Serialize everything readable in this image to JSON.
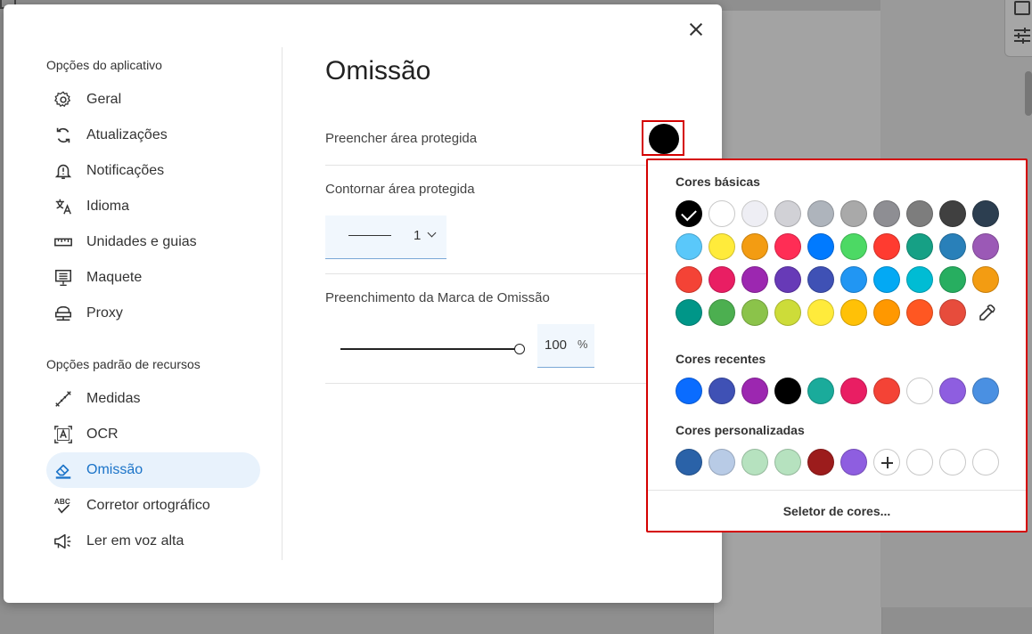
{
  "dialog": {
    "title": "Omissão",
    "close_label": "close"
  },
  "sidebar": {
    "app_section_title": "Opções do aplicativo",
    "resource_section_title": "Opções padrão de recursos",
    "app_items": [
      {
        "label": "Geral",
        "icon": "gear-icon"
      },
      {
        "label": "Atualizações",
        "icon": "refresh-icon"
      },
      {
        "label": "Notificações",
        "icon": "bell-alert-icon"
      },
      {
        "label": "Idioma",
        "icon": "translate-icon"
      },
      {
        "label": "Unidades e guias",
        "icon": "ruler-icon"
      },
      {
        "label": "Maquete",
        "icon": "monitor-icon"
      },
      {
        "label": "Proxy",
        "icon": "proxy-icon"
      }
    ],
    "resource_items": [
      {
        "label": "Medidas",
        "icon": "measure-icon"
      },
      {
        "label": "OCR",
        "icon": "ocr-icon"
      },
      {
        "label": "Omissão",
        "icon": "eraser-icon",
        "active": true
      },
      {
        "label": "Corretor ortográfico",
        "icon": "spellcheck-icon"
      },
      {
        "label": "Ler em voz alta",
        "icon": "megaphone-icon"
      }
    ]
  },
  "settings": {
    "fill_label": "Preencher área protegida",
    "fill_color": "#000000",
    "outline_label": "Contornar área protegida",
    "outline_width": "1",
    "mark_fill_label": "Preenchimento da Marca de Omissão",
    "opacity_value": "100",
    "opacity_unit": "%",
    "opacity_fraction": 1.0
  },
  "color_popup": {
    "basic_title": "Cores básicas",
    "recent_title": "Cores recentes",
    "custom_title": "Cores personalizadas",
    "picker_label": "Seletor de cores...",
    "selected_color": "#000000",
    "basic_colors": [
      "#000000",
      "#ffffff",
      "#eeeef4",
      "#d1d1d6",
      "#aeb4bc",
      "#a9a9a9",
      "#8e8e93",
      "#7d7d7d",
      "#404040",
      "#2c3e50",
      "#5ac8fa",
      "#ffeb3b",
      "#f39c12",
      "#ff2d55",
      "#007aff",
      "#4cd964",
      "#ff3b30",
      "#16a085",
      "#2980b9",
      "#9b59b6",
      "#f44336",
      "#e91e63",
      "#9c27b0",
      "#673ab7",
      "#3f51b5",
      "#2196f3",
      "#03a9f4",
      "#00bcd4",
      "#27ae60",
      "#f39c12",
      "#009688",
      "#4caf50",
      "#8bc34a",
      "#cddc39",
      "#ffeb3b",
      "#ffc107",
      "#ff9800",
      "#ff5722",
      "#e74c3c"
    ],
    "recent_colors": [
      "#0a6cff",
      "#3f51b5",
      "#9c27b0",
      "#000000",
      "#1aab9b",
      "#e91e63",
      "#f44336",
      "#ffffff",
      "#8e5ee0",
      "#4a90e2"
    ],
    "custom_colors": [
      "#2a62a8",
      "#b8cbe6",
      "#b6e2bf",
      "#b6e2bf",
      "#9c1c1c",
      "#8e5ee0"
    ],
    "custom_empty_slots": 3
  }
}
